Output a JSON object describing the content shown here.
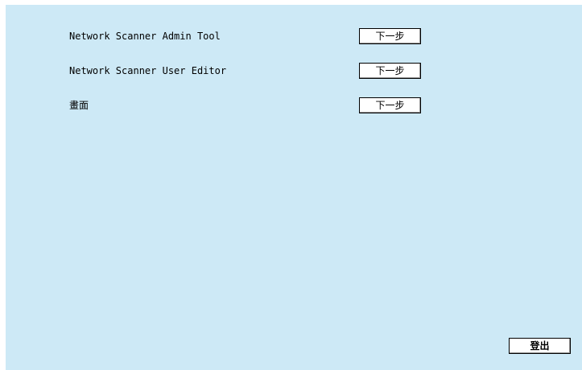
{
  "rows": [
    {
      "label": "Network Scanner Admin Tool",
      "button_label": "下一步"
    },
    {
      "label": "Network Scanner User Editor",
      "button_label": "下一步"
    },
    {
      "label": "畫面",
      "button_label": "下一步"
    }
  ],
  "logout_label": "登出",
  "colors": {
    "panel_background": "#cde9f6",
    "page_background": "#ffffff"
  }
}
